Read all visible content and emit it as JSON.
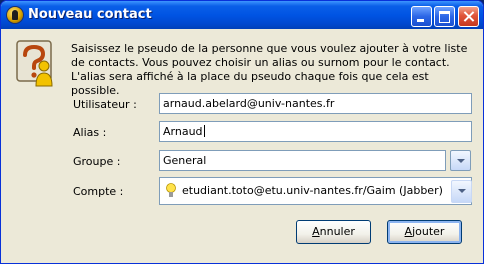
{
  "window": {
    "title": "Nouveau contact"
  },
  "dialog": {
    "message": "Saisissez le pseudo de la personne que vous voulez ajouter à votre liste de contacts. Vous pouvez choisir un alias ou surnom pour le contact. L'alias sera affiché à la place du pseudo chaque fois que cela est possible."
  },
  "form": {
    "user_label": "Utilisateur :",
    "user_value": "arnaud.abelard@univ-nantes.fr",
    "alias_label": "Alias :",
    "alias_value": "Arnaud",
    "group_label": "Groupe :",
    "group_value": "General",
    "account_label": "Compte :",
    "account_value": "etudiant.toto@etu.univ-nantes.fr/Gaim (Jabber)"
  },
  "buttons": {
    "cancel_mnemonic": "A",
    "cancel_rest": "nnuler",
    "add_mnemonic": "A",
    "add_rest": "jouter"
  }
}
